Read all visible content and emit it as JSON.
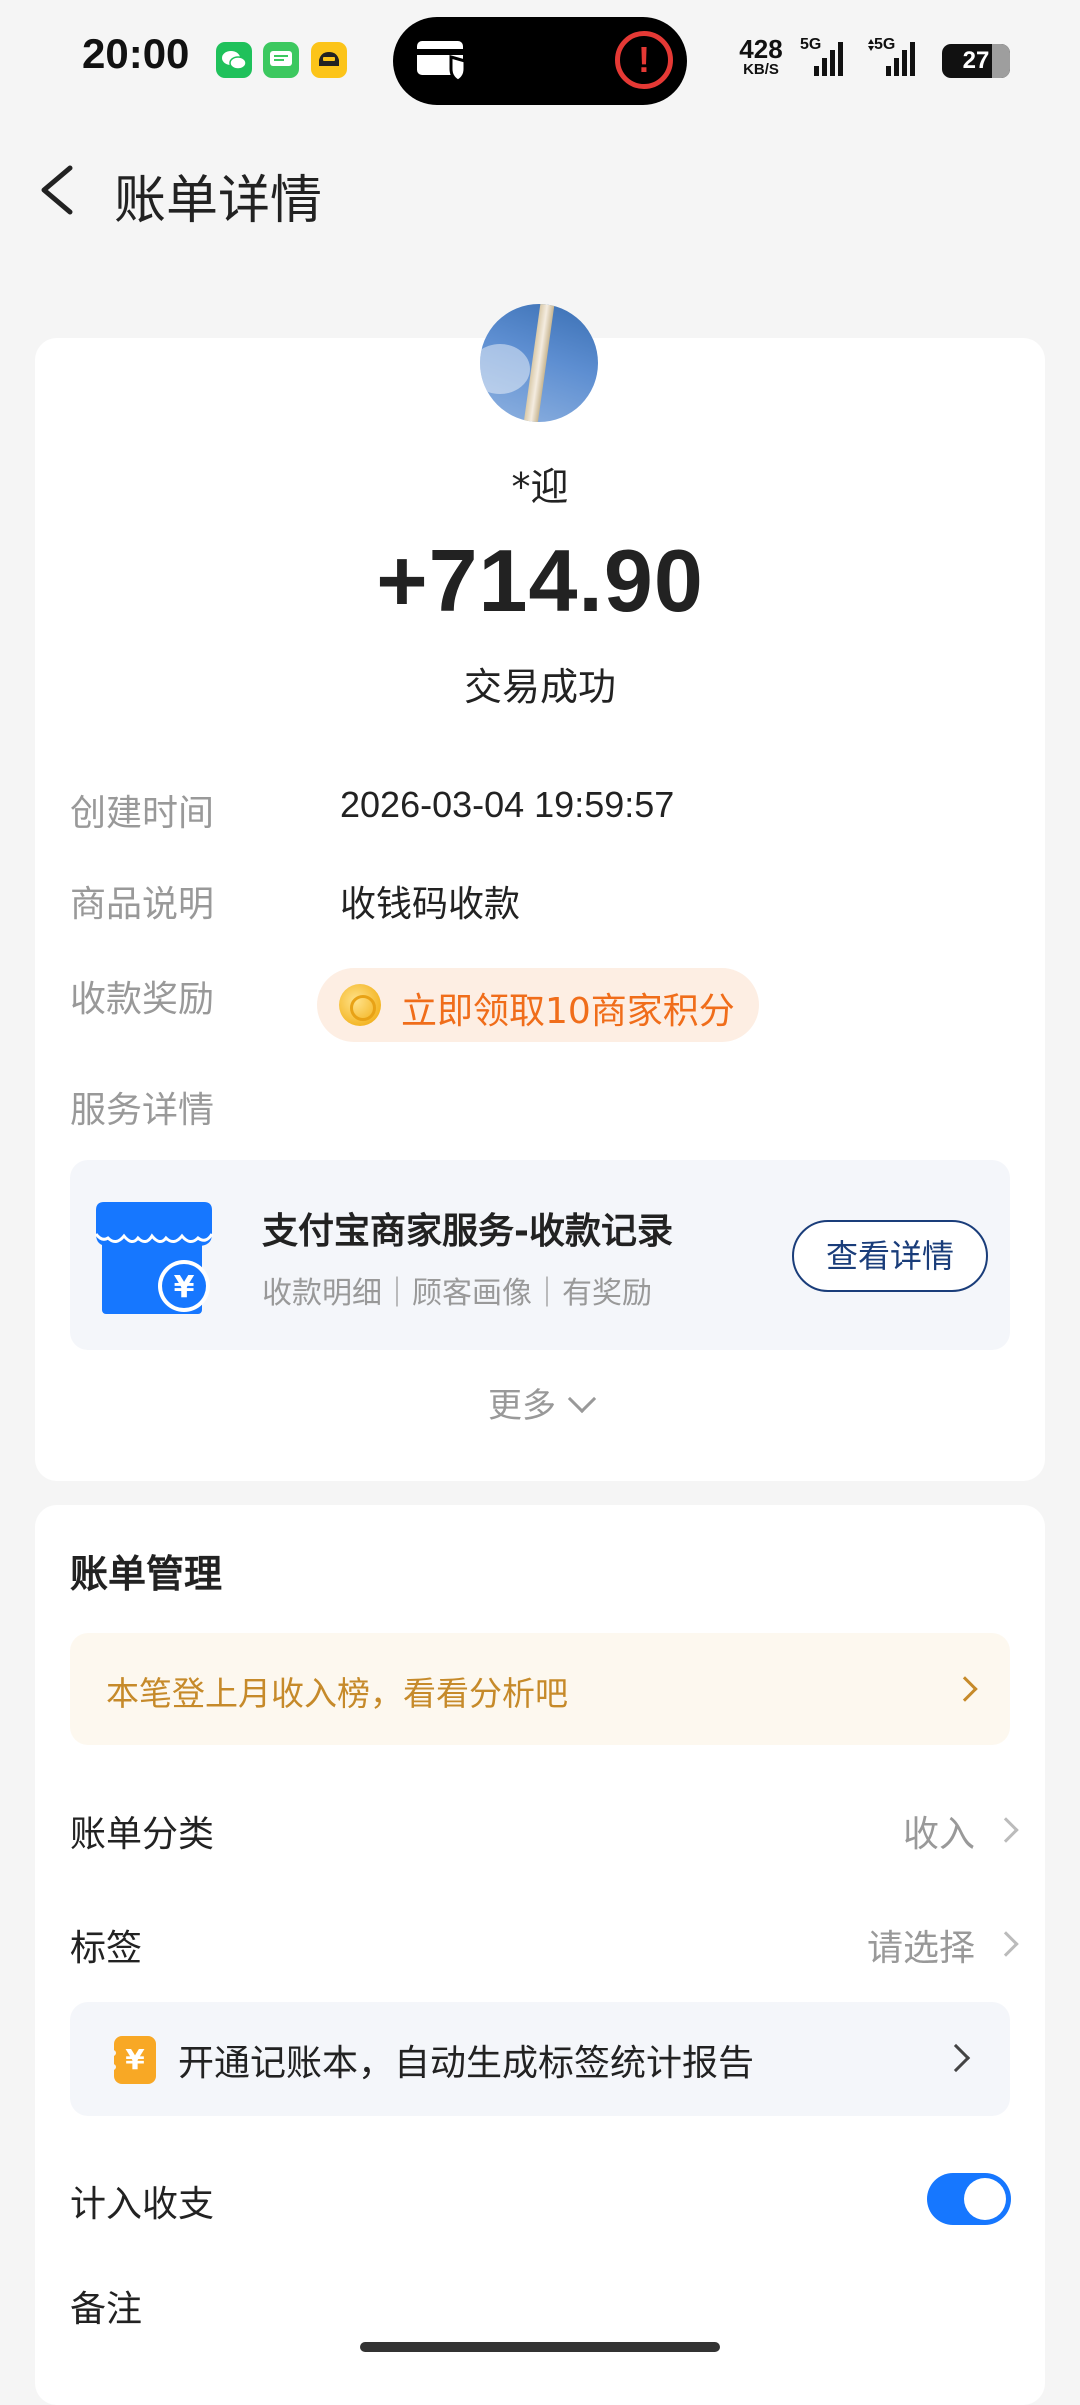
{
  "status_bar": {
    "time": "20:00",
    "net_speed_value": "428",
    "net_speed_unit": "KB/S",
    "signal_1_label": "5G",
    "signal_2_label": "5G",
    "battery": "27",
    "battery_level": 0.27
  },
  "header": {
    "title": "账单详情"
  },
  "bill": {
    "payer_name": "*迎",
    "amount": "+714.90",
    "status": "交易成功",
    "created_label": "创建时间",
    "created_value": "2026-03-04 19:59:57",
    "desc_label": "商品说明",
    "desc_value": "收钱码收款",
    "reward_label": "收款奖励",
    "reward_text": "立即领取10商家积分",
    "service_label": "服务详情",
    "service": {
      "title": "支付宝商家服务-收款记录",
      "subtitle": "收款明细｜顾客画像｜有奖励",
      "button": "查看详情"
    },
    "more": "更多"
  },
  "manage": {
    "title": "账单管理",
    "notice": "本笔登上月收入榜，看看分析吧",
    "category_label": "账单分类",
    "category_value": "收入",
    "tag_label": "标签",
    "tag_value": "请选择",
    "account_book_text": "开通记账本，自动生成标签统计报告",
    "account_book_icon": "¥",
    "count_label": "计入收支",
    "count_enabled": true,
    "remark_label": "备注"
  },
  "colors": {
    "accent": "#1677ff",
    "reward_text": "#f06d1a",
    "notice_text": "#c68a2a",
    "button_border": "#1a3d7a"
  }
}
